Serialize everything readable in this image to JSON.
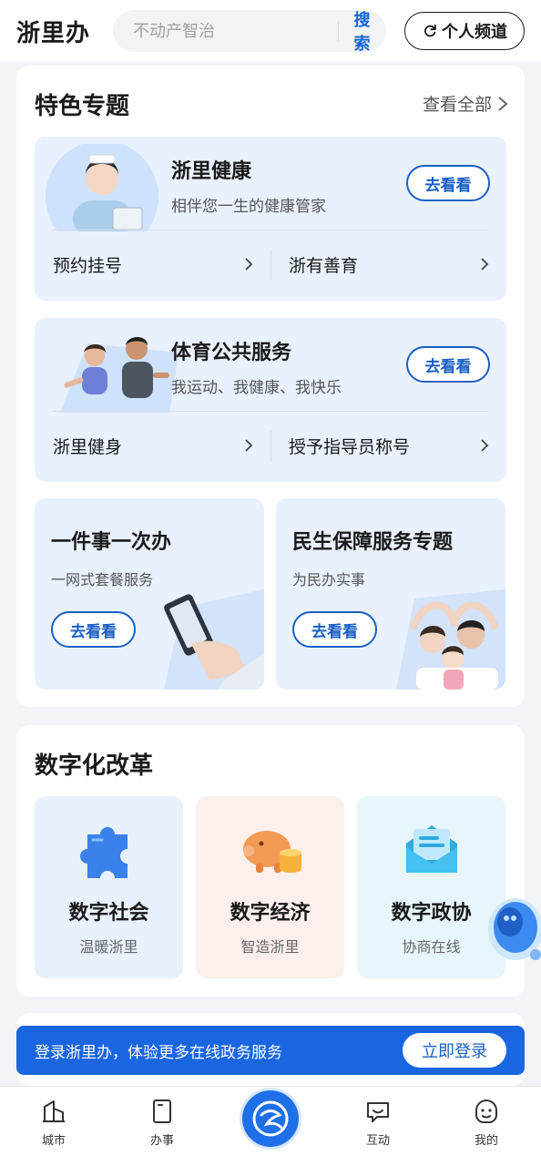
{
  "header": {
    "logo": "浙里办",
    "search_placeholder": "不动产智治",
    "search_button": "搜索",
    "channel_button": "个人频道",
    "channel_icon": "refresh-icon"
  },
  "featured": {
    "title": "特色专题",
    "see_all": "查看全部",
    "health": {
      "title": "浙里健康",
      "subtitle": "相伴您一生的健康管家",
      "button": "去看看",
      "links": [
        "预约挂号",
        "浙有善育"
      ]
    },
    "sport": {
      "title": "体育公共服务",
      "subtitle": "我运动、我健康、我快乐",
      "button": "去看看",
      "links": [
        "浙里健身",
        "授予指导员称号"
      ]
    },
    "one_thing": {
      "title": "一件事一次办",
      "subtitle": "一网式套餐服务",
      "button": "去看看"
    },
    "livelihood": {
      "title": "民生保障服务专题",
      "subtitle": "为民办实事",
      "button": "去看看"
    }
  },
  "digital": {
    "title": "数字化改革",
    "cards": [
      {
        "title": "数字社会",
        "subtitle": "温暖浙里",
        "icon": "puzzle-icon"
      },
      {
        "title": "数字经济",
        "subtitle": "智造浙里",
        "icon": "piggy-bank-icon"
      },
      {
        "title": "数字政协",
        "subtitle": "协商在线",
        "icon": "envelope-icon"
      }
    ]
  },
  "login_bar": {
    "text": "登录浙里办，体验更多在线政务服务",
    "button": "立即登录"
  },
  "bottom_nav": {
    "items": [
      {
        "label": "城市",
        "icon": "city-icon"
      },
      {
        "label": "办事",
        "icon": "document-icon"
      },
      {
        "label": "",
        "icon": "zheliban-logo-icon"
      },
      {
        "label": "互动",
        "icon": "chat-icon"
      },
      {
        "label": "我的",
        "icon": "smile-icon"
      }
    ]
  },
  "colors": {
    "accent": "#1a66e0",
    "card_blue": "#e8f1fd",
    "card_peach": "#fdf0ec",
    "card_cyan": "#e6f6fb"
  }
}
